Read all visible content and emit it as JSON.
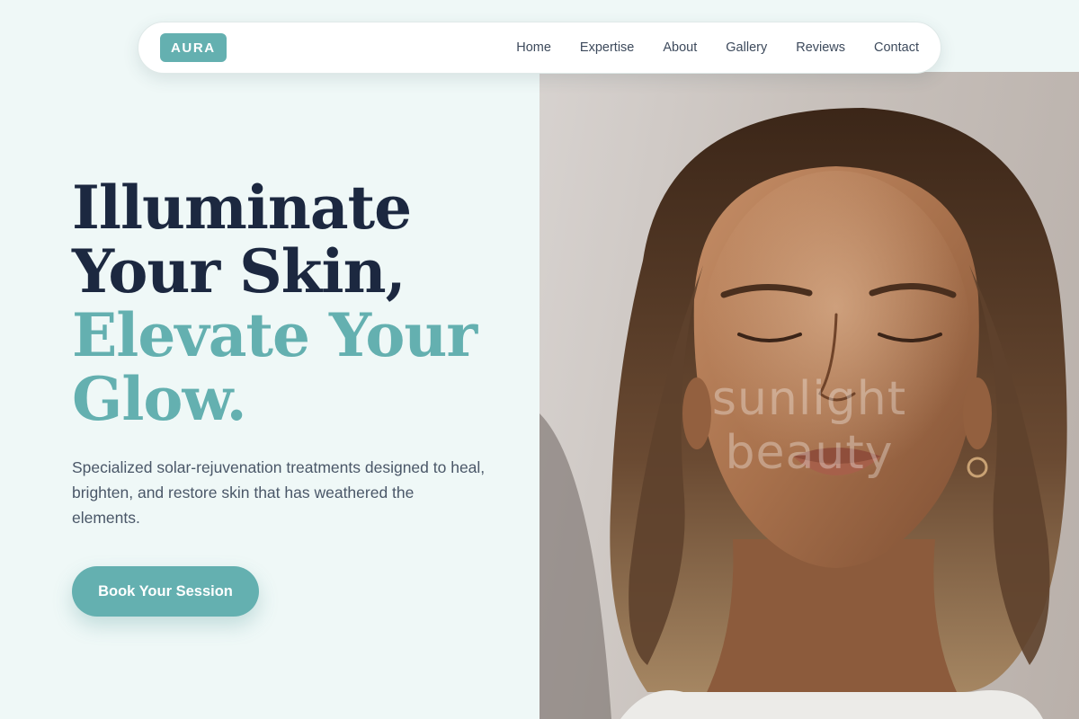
{
  "brand": {
    "logo_text": "AURA"
  },
  "nav": {
    "links": [
      "Home",
      "Expertise",
      "About",
      "Gallery",
      "Reviews",
      "Contact"
    ]
  },
  "hero": {
    "headline_dark": [
      "Illuminate",
      "Your Skin,"
    ],
    "headline_accent": [
      "Elevate Your",
      "Glow."
    ],
    "description": "Specialized solar-rejuvenation treatments designed to heal, brighten, and restore skin that has weathered the elements.",
    "cta_label": "Book Your Session"
  },
  "image": {
    "subject": "woman-face-eyes-closed",
    "watermark_text": "sunlight beauty"
  },
  "colors": {
    "accent": "#64b0b0",
    "heading": "#1c2840",
    "body_text": "#4a5768",
    "background": "#eff8f7"
  }
}
